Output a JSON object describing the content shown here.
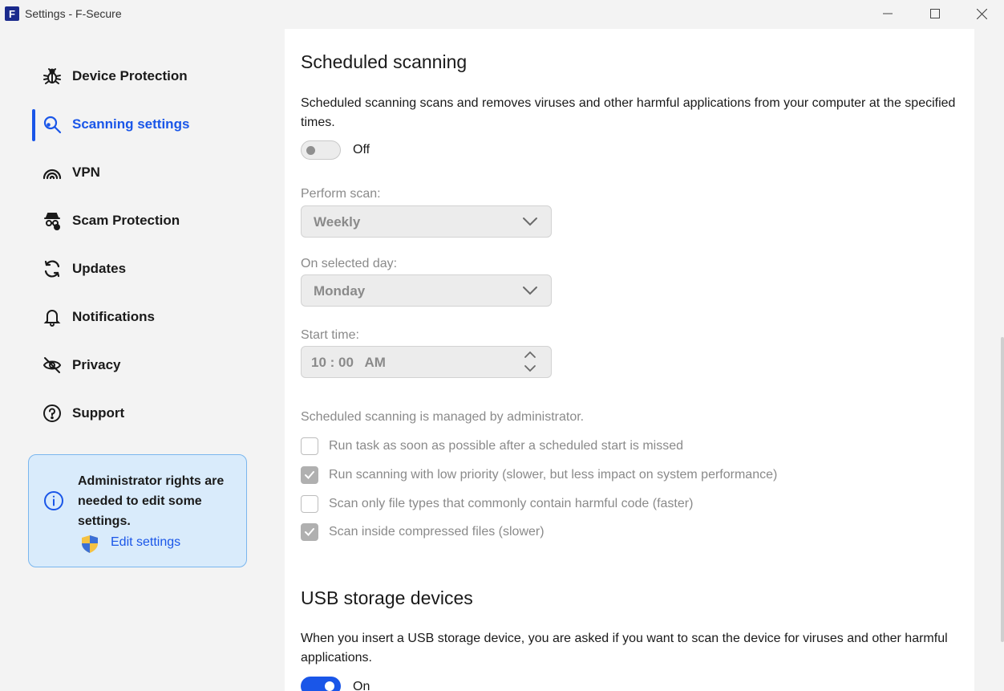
{
  "window": {
    "title": "Settings - F-Secure",
    "logo_letter": "F"
  },
  "sidebar": {
    "items": [
      {
        "label": "Device Protection",
        "icon": "bug-icon"
      },
      {
        "label": "Scanning settings",
        "icon": "scan-gear-icon",
        "active": true
      },
      {
        "label": "VPN",
        "icon": "vpn-icon"
      },
      {
        "label": "Scam Protection",
        "icon": "scam-protection-icon"
      },
      {
        "label": "Updates",
        "icon": "refresh-icon"
      },
      {
        "label": "Notifications",
        "icon": "bell-icon"
      },
      {
        "label": "Privacy",
        "icon": "eye-off-icon"
      },
      {
        "label": "Support",
        "icon": "question-icon"
      }
    ],
    "admin_notice": {
      "message": "Administrator rights are needed to edit some settings.",
      "link": "Edit settings"
    }
  },
  "scheduled": {
    "title": "Scheduled scanning",
    "description": "Scheduled scanning scans and removes viruses and other harmful applications from your computer at the specified times.",
    "toggle_state": "Off",
    "perform_label": "Perform scan:",
    "perform_value": "Weekly",
    "day_label": "On selected day:",
    "day_value": "Monday",
    "time_label": "Start time:",
    "time_value": "10 : 00   AM",
    "managed_note": "Scheduled scanning is managed by administrator.",
    "options": [
      {
        "label": "Run task as soon as possible after a scheduled start is missed",
        "checked": false
      },
      {
        "label": "Run scanning with low priority (slower, but less impact on system performance)",
        "checked": true
      },
      {
        "label": "Scan only file types that commonly contain harmful code (faster)",
        "checked": false
      },
      {
        "label": "Scan inside compressed files (slower)",
        "checked": true
      }
    ]
  },
  "usb": {
    "title": "USB storage devices",
    "description": "When you insert a USB storage device, you are asked if you want to scan the device for viruses and other harmful applications.",
    "toggle_state": "On"
  },
  "colors": {
    "accent": "#1a56e8",
    "card_bg": "#d9ebfb",
    "card_border": "#7ab6ee",
    "disabled_text": "#8a8a8a"
  }
}
